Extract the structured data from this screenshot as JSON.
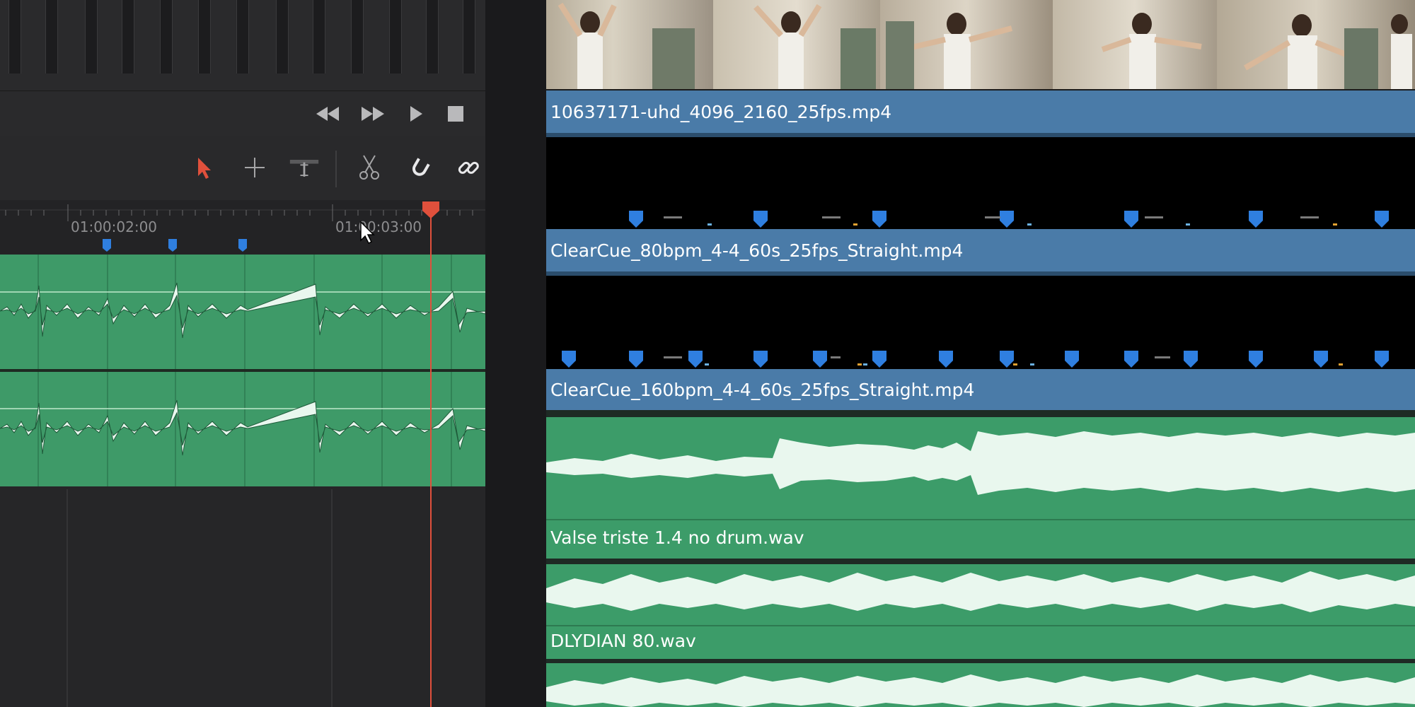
{
  "ruler": {
    "timecode_a": "01:00:02:00",
    "timecode_b": "01:00:03:00"
  },
  "tracks": [
    {
      "name": "10637171-uhd_4096_2160_25fps.mp4",
      "type": "video"
    },
    {
      "name": "ClearCue_80bpm_4-4_60s_25fps_Straight.mp4",
      "type": "video"
    },
    {
      "name": "ClearCue_160bpm_4-4_60s_25fps_Straight.mp4",
      "type": "video"
    },
    {
      "name": "Valse triste 1.4 no drum.wav",
      "type": "audio"
    },
    {
      "name": "DLYDIAN 80.wav",
      "type": "audio"
    }
  ],
  "icons": {
    "transport": [
      "rewind-icon",
      "fast-forward-icon",
      "play-icon",
      "stop-icon"
    ],
    "tools": [
      "selection-arrow-icon",
      "trim-icon",
      "dynamic-trim-icon",
      "blade-icon",
      "snapping-icon",
      "linked-selection-icon"
    ]
  },
  "colors": {
    "video_clip": "#4a7ba8",
    "audio_clip": "#3c9c69",
    "playhead": "#e0503c",
    "marker": "#2f7fe0",
    "selection_tool": "#e0503c"
  }
}
